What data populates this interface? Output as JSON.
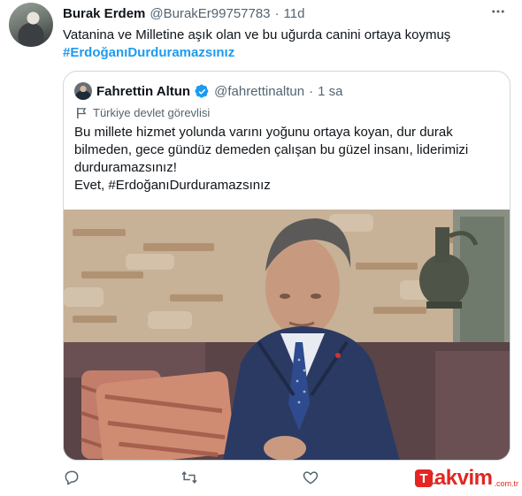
{
  "tweet": {
    "display_name": "Burak Erdem",
    "handle": "@BurakEr99757783",
    "separator": "·",
    "time": "11d",
    "more_icon": "ellipsis-icon",
    "text": "Vatanina ve Milletine aşık olan ve bu uğurda canini ortaya koymuş",
    "hashtag": "#ErdoğanıDurduramazsınız"
  },
  "quote": {
    "display_name": "Fahrettin Altun",
    "verified_icon": "verified-badge-icon",
    "handle": "@fahrettinaltun",
    "separator": "·",
    "time": "1 sa",
    "label": "Türkiye devlet görevlisi",
    "text_lines": [
      "Bu millete hizmet yolunda varını yoğunu ortaya koyan, dur durak",
      "bilmeden, gece gündüz demeden çalışan bu güzel insanı, liderimizi",
      "durduramazsınız!",
      "Evet, #ErdoğanıDurduramazsınız"
    ]
  },
  "actions": {
    "reply_icon": "reply-icon",
    "retweet_icon": "retweet-icon",
    "like_icon": "like-icon",
    "share_icon": "share-icon"
  },
  "watermark": {
    "letter": "T",
    "text": "akvim",
    "sub": ".com.tr"
  },
  "colors": {
    "text": "#0f1419",
    "secondary": "#536471",
    "link": "#1d9bf0",
    "border": "#cfd9de",
    "watermark": "#e42521"
  }
}
